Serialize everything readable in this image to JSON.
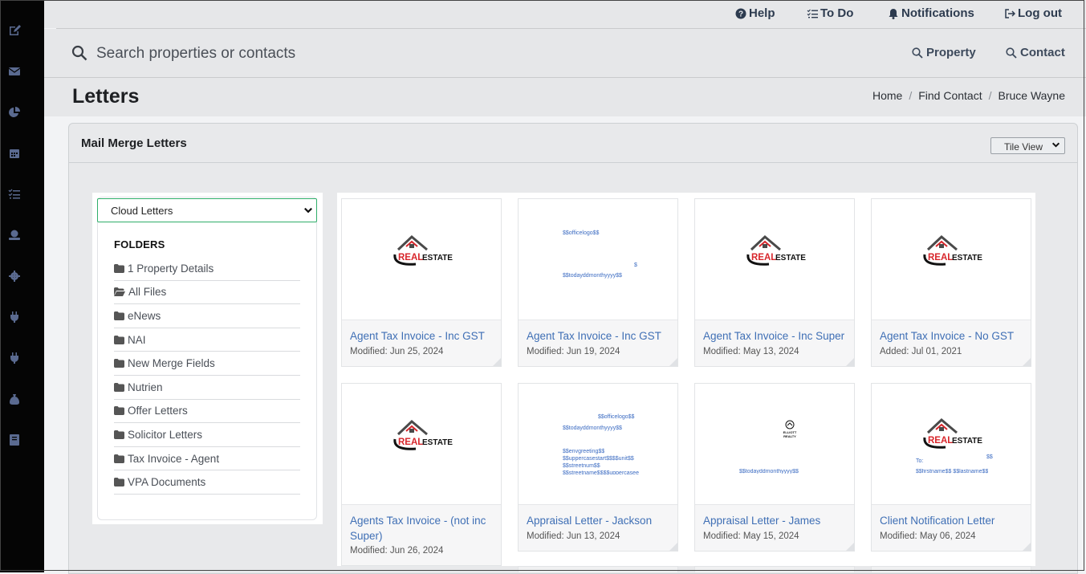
{
  "topnav": {
    "help": "Help",
    "todo": "To Do",
    "notifications": "Notifications",
    "logout": "Log out"
  },
  "search": {
    "placeholder": "Search properties or contacts",
    "property": "Property",
    "contact": "Contact"
  },
  "page": {
    "title": "Letters",
    "breadcrumb": [
      "Home",
      "Find Contact",
      "Bruce Wayne"
    ]
  },
  "card": {
    "title": "Mail Merge Letters",
    "view_select": "Tile View"
  },
  "folders": {
    "source_select": "Cloud Letters",
    "heading": "FOLDERS",
    "items": [
      "1 Property Details",
      "All Files",
      "eNews",
      "NAI",
      "New Merge Fields",
      "Nutrien",
      "Offer Letters",
      "Solicitor Letters",
      "Tax Invoice - Agent",
      "VPA Documents"
    ]
  },
  "logo": {
    "text_red": "REAL",
    "text_black": "ESTATE",
    "small": "ELLIOTT REALTY"
  },
  "colors": {
    "rail": "#050505",
    "link_blue": "#3f6fb5",
    "logo_red": "#d8262b",
    "select_border": "#2fae6a"
  },
  "tiles": [
    {
      "name": "Agent Tax Invoice - Inc GST",
      "meta": "Modified: Jun 25, 2024",
      "thumb": "logo"
    },
    {
      "name": "Agent Tax Invoice - Inc GST",
      "meta": "Modified: Jun 19, 2024",
      "thumb": "template1",
      "fields": [
        "$$officelogo$$",
        "$",
        "$$todayddmonthyyyy$$"
      ]
    },
    {
      "name": "Agent Tax Invoice - Inc Super",
      "meta": "Modified: May 13, 2024",
      "thumb": "logo"
    },
    {
      "name": "Agent Tax Invoice - No GST",
      "meta": "Added: Jul 01, 2021",
      "thumb": "logo"
    },
    {
      "name": "Agents Tax Invoice - (not inc Super)",
      "meta": "Modified: Jun 26, 2024",
      "thumb": "logo"
    },
    {
      "name": "Appraisal Letter - Jackson",
      "meta": "Modified: Jun 13, 2024",
      "thumb": "template2",
      "fields": [
        "$$officelogo$$",
        "$$todayddmonthyyyy$$",
        "$$envgreeting$$",
        "$$uppercasestart$$$$unit$$",
        "$$streetnum$$",
        "$$streetname$$$$uppercasee"
      ]
    },
    {
      "name": "Appraisal Letter - James",
      "meta": "Modified: May 15, 2024",
      "thumb": "template3",
      "fields": [
        "$$todayddmonthyyyy$$"
      ]
    },
    {
      "name": "Client Notification Letter",
      "meta": "Modified: May 06, 2024",
      "thumb": "logo2",
      "fields": [
        "$$",
        "To:",
        "$$firstname$$ $$lastname$$"
      ]
    }
  ]
}
